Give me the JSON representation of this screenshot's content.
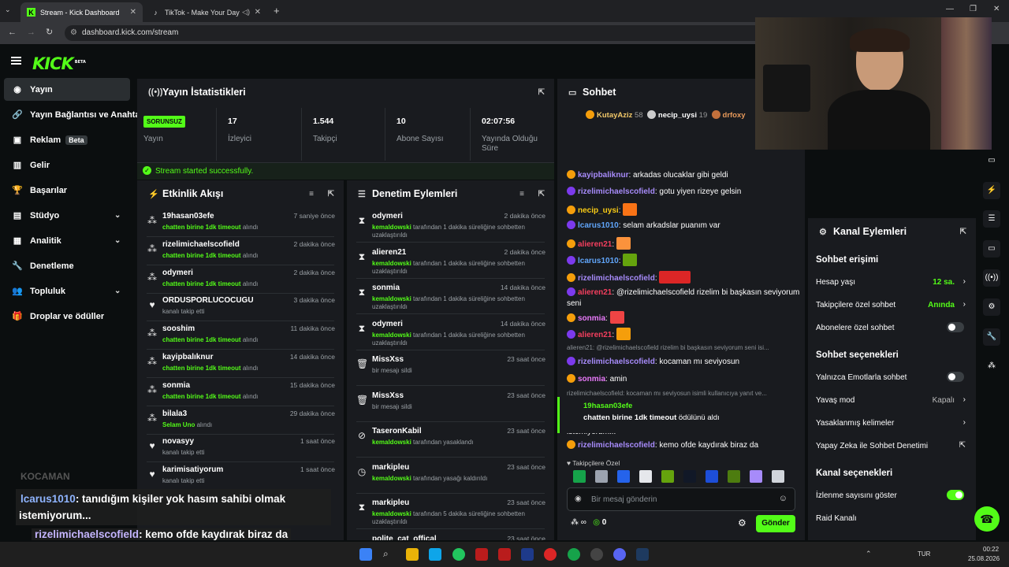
{
  "browser": {
    "tabs": [
      {
        "label": "Stream - Kick Dashboard"
      },
      {
        "label": "TikTok - Make Your Day"
      }
    ],
    "url": "dashboard.kick.com/stream"
  },
  "logo": {
    "text": "KICK",
    "beta": "BETA"
  },
  "sidebar": {
    "items": [
      {
        "label": "Yayın",
        "icon": "broadcast-icon"
      },
      {
        "label": "Yayın Bağlantısı ve Anahtarı",
        "icon": "link-icon"
      },
      {
        "label": "Reklam",
        "icon": "ad-icon",
        "badge": "Beta"
      },
      {
        "label": "Gelir",
        "icon": "chart-icon"
      },
      {
        "label": "Başarılar",
        "icon": "trophy-icon"
      },
      {
        "label": "Stüdyo",
        "icon": "studio-icon"
      },
      {
        "label": "Analitik",
        "icon": "analytics-icon"
      },
      {
        "label": "Denetleme",
        "icon": "wrench-icon"
      },
      {
        "label": "Topluluk",
        "icon": "community-icon"
      },
      {
        "label": "Droplar ve ödüller",
        "icon": "gift-icon"
      }
    ]
  },
  "stats": {
    "title": "Yayın İstatistikleri",
    "status_badge": "SORUNSUZ",
    "status_label": "Yayın",
    "items": [
      {
        "value": "17",
        "label": "İzleyici"
      },
      {
        "value": "1.544",
        "label": "Takipçi"
      },
      {
        "value": "10",
        "label": "Abone Sayısı"
      },
      {
        "value": "02:07:56",
        "label": "Yayında Olduğu Süre"
      }
    ],
    "success": "Stream started successfully."
  },
  "activity": {
    "title": "Etkinlik Akışı",
    "events": [
      {
        "name": "19hasan03efe",
        "action": "chatten birine 1dk timeout",
        "suffix": "alındı",
        "time": "7 saniye önce",
        "icon": "reward-icon"
      },
      {
        "name": "rizelimichaelscofield",
        "action": "chatten birine 1dk timeout",
        "suffix": "alındı",
        "time": "2 dakika önce",
        "icon": "reward-icon"
      },
      {
        "name": "odymeri",
        "action": "chatten birine 1dk timeout",
        "suffix": "alındı",
        "time": "2 dakika önce",
        "icon": "reward-icon"
      },
      {
        "name": "ORDUSPORLUCOCUGU",
        "action": "",
        "suffix": "kanalı takip etti",
        "time": "3 dakika önce",
        "icon": "heart-icon"
      },
      {
        "name": "sooshim",
        "action": "chatten birine 1dk timeout",
        "suffix": "alındı",
        "time": "11 dakika önce",
        "icon": "reward-icon"
      },
      {
        "name": "kayipbalıknur",
        "action": "chatten birine 1dk timeout",
        "suffix": "alındı",
        "time": "14 dakika önce",
        "icon": "reward-icon"
      },
      {
        "name": "sonmia",
        "action": "chatten birine 1dk timeout",
        "suffix": "alındı",
        "time": "15 dakika önce",
        "icon": "reward-icon"
      },
      {
        "name": "bilala3",
        "action": "Selam Uno",
        "suffix": "alındı",
        "time": "29 dakika önce",
        "icon": "reward-icon"
      },
      {
        "name": "novasyy",
        "action": "",
        "suffix": "kanalı takip etti",
        "time": "1 saat önce",
        "icon": "heart-icon"
      },
      {
        "name": "karimisatiyorum",
        "action": "",
        "suffix": "kanalı takip etti",
        "time": "1 saat önce",
        "icon": "heart-icon"
      }
    ]
  },
  "moderation": {
    "title": "Denetim Eylemleri",
    "events": [
      {
        "name": "odymeri",
        "mod": "kemaldowski",
        "text": "tarafından 1 dakika süreliğine sohbetten uzaklaştırıldı",
        "time": "2 dakika önce",
        "icon": "hourglass-icon"
      },
      {
        "name": "alieren21",
        "mod": "kemaldowski",
        "text": "tarafından 1 dakika süreliğine sohbetten uzaklaştırıldı",
        "time": "2 dakika önce",
        "icon": "hourglass-icon"
      },
      {
        "name": "sonmia",
        "mod": "kemaldowski",
        "text": "tarafından 1 dakika süreliğine sohbetten uzaklaştırıldı",
        "time": "14 dakika önce",
        "icon": "hourglass-icon"
      },
      {
        "name": "odymeri",
        "mod": "kemaldowski",
        "text": "tarafından 1 dakika süreliğine sohbetten uzaklaştırıldı",
        "time": "14 dakika önce",
        "icon": "hourglass-icon"
      },
      {
        "name": "MissXss",
        "mod": "",
        "text": "bir mesajı sildi",
        "time": "23 saat önce",
        "icon": "trash-icon"
      },
      {
        "name": "MissXss",
        "mod": "",
        "text": "bir mesajı sildi",
        "time": "23 saat önce",
        "icon": "trash-icon"
      },
      {
        "name": "TaseronKabil",
        "mod": "kemaldowski",
        "text": "tarafından yasaklandı",
        "time": "23 saat önce",
        "icon": "ban-icon"
      },
      {
        "name": "markipleu",
        "mod": "kemaldowski",
        "text": "tarafından yasağı kaldırıldı",
        "time": "23 saat önce",
        "icon": "clock-icon"
      },
      {
        "name": "markipleu",
        "mod": "kemaldowski",
        "text": "tarafından 5 dakika süreliğine sohbetten uzaklaştırıldı",
        "time": "23 saat önce",
        "icon": "hourglass-icon"
      },
      {
        "name": "polite_cat_offical",
        "mod": "kemaldowski",
        "text": "tarafından 1 dakika süreliğine sohbetten uzaklaştırıldı",
        "time": "23 saat önce",
        "icon": "hourglass-icon"
      }
    ]
  },
  "chat": {
    "title": "Sohbet",
    "top_gifters": [
      {
        "name": "KutayAziz",
        "count": "58"
      },
      {
        "name": "necip_uysi",
        "count": "19"
      },
      {
        "name": "drfoxy",
        "count": ""
      }
    ],
    "messages": [
      {
        "user": "kayipbaliknur",
        "color": "#a78bfa",
        "text": "arkadas olucaklar gibi geldi"
      },
      {
        "user": "rizelimichaelscofield",
        "color": "#a78bfa",
        "text": "gotu yiyen rizeye gelsin"
      },
      {
        "user": "necip_uysi",
        "color": "#facc15",
        "text": ""
      },
      {
        "user": "lcarus1010",
        "color": "#60a5fa",
        "text": "selam arkadslar puanım var"
      },
      {
        "user": "alieren21",
        "color": "#f43f5e",
        "text": ""
      },
      {
        "user": "lcarus1010",
        "color": "#60a5fa",
        "text": ""
      },
      {
        "user": "rizelimichaelscofield",
        "color": "#a78bfa",
        "text": ""
      },
      {
        "user": "alieren21",
        "color": "#f43f5e",
        "text": "@rizelimichaelscofield rizelim bi başkasın seviyorum seni"
      },
      {
        "user": "sonmia",
        "color": "#e879f9",
        "text": ""
      },
      {
        "user": "alieren21",
        "color": "#f43f5e",
        "text": ""
      },
      {
        "reply": "alieren21: @rizelimichaelscofield rizelim bi başkasın seviyorum seni isi..."
      },
      {
        "user": "rizelimichaelscofield",
        "color": "#a78bfa",
        "text": "kocaman mı seviyosun"
      },
      {
        "user": "sonmia",
        "color": "#e879f9",
        "text": "amin"
      },
      {
        "reply": "rizelimichaelscofield: kocaman mı seviyosun isimli kullanıcıya yanıt ve..."
      },
      {
        "user": "alieren21",
        "color": "#f43f5e",
        "text": "KOCAMAN KOCAMAN"
      },
      {
        "user": "lcarus1010",
        "color": "#60a5fa",
        "text": "tanıdığım kişiler yok hasım sahibi olmak istemiyorum..."
      }
    ],
    "reward": {
      "user": "19hasan03efe",
      "title": "chatten birine 1dk timeout",
      "suffix": "ödülünü aldı"
    },
    "last": {
      "user": "rizelimichaelscofield",
      "text": "kemo ofde kaydırak biraz da"
    },
    "emote_label": "Takipçilere Özel",
    "placeholder": "Bir mesaj gönderin",
    "send": "Gönder",
    "infinity": "∞",
    "points": "0"
  },
  "channel_actions": {
    "title": "Kanal Eylemleri",
    "sections": [
      {
        "title": "Sohbet erişimi",
        "rows": [
          {
            "label": "Hesap yaşı",
            "value": "12 sa."
          },
          {
            "label": "Takipçilere özel sohbet",
            "value": "Anında"
          },
          {
            "label": "Abonelere özel sohbet",
            "toggle": false
          }
        ]
      },
      {
        "title": "Sohbet seçenekleri",
        "rows": [
          {
            "label": "Yalnızca Emotlarla sohbet",
            "toggle": false
          },
          {
            "label": "Yavaş mod",
            "value": "Kapalı"
          },
          {
            "label": "Yasaklanmış kelimeler"
          },
          {
            "label": "Yapay Zeka ile Sohbet Denetimi"
          }
        ]
      },
      {
        "title": "Kanal seçenekleri",
        "rows": [
          {
            "label": "İzlenme sayısını göster",
            "toggle": true
          },
          {
            "label": "Raid Kanalı"
          }
        ]
      }
    ]
  },
  "overlay": {
    "line0": "KOCAMAN",
    "line1_user": "lcarus1010",
    "line1_text": ": tanıdığım kişiler yok hasım sahibi olmak",
    "line1_cont": "istemiyorum...",
    "line2_user": "rizelimichaelscofield",
    "line2_text": ": kemo ofde kaydırak biraz da"
  },
  "taskbar": {
    "lang": "TUR",
    "time": "00:22",
    "date": "25.08.2026"
  },
  "colors": {
    "accent": "#53fc18",
    "panel": "#191b1f",
    "bg": "#0b0e0f"
  }
}
